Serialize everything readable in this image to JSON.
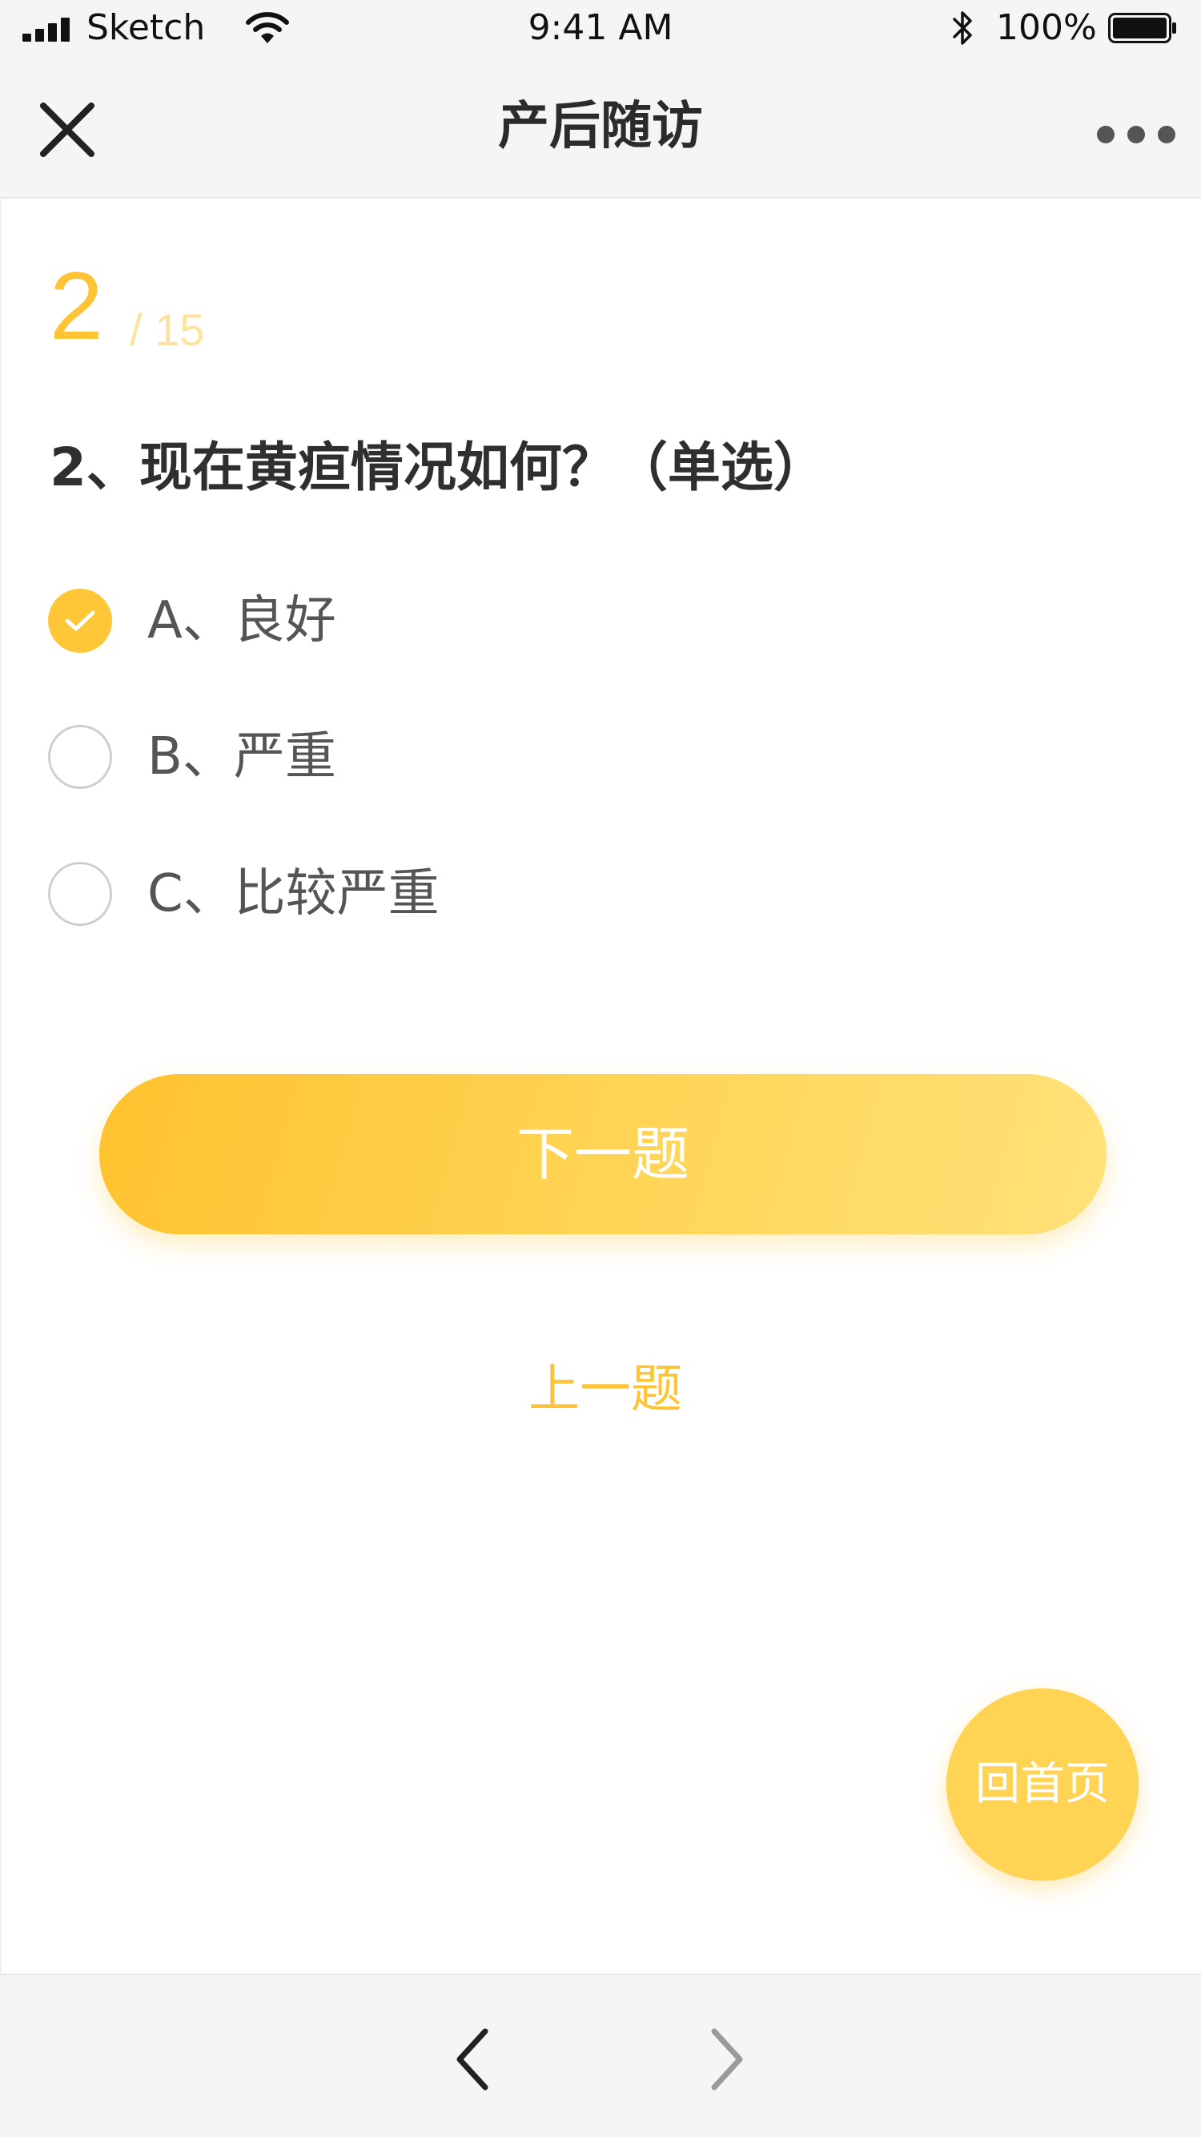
{
  "status_bar": {
    "carrier": "Sketch",
    "time": "9:41 AM",
    "battery_percent": "100%",
    "icons": [
      "signal-icon",
      "wifi-icon",
      "bluetooth-icon",
      "battery-icon"
    ]
  },
  "nav": {
    "title": "产后随访",
    "close_icon": "close-icon",
    "more_icon": "more-icon"
  },
  "progress": {
    "current": "2",
    "total": "/ 15"
  },
  "question": {
    "text": "2、现在黄疸情况如何？（单选）"
  },
  "options": [
    {
      "label": "A、良好",
      "selected": true
    },
    {
      "label": "B、严重",
      "selected": false
    },
    {
      "label": "C、比较严重",
      "selected": false
    }
  ],
  "actions": {
    "next_label": "下一题",
    "prev_label": "上一题",
    "home_label": "回首页"
  },
  "toolbar": {
    "back_icon": "chevron-left-icon",
    "forward_icon": "chevron-right-icon"
  },
  "colors": {
    "accent": "#ffc435",
    "accent_light": "#ffe2a0",
    "text_dark": "#2f2f2f",
    "text_option": "#555555",
    "bar_bg": "#f5f5f5"
  }
}
